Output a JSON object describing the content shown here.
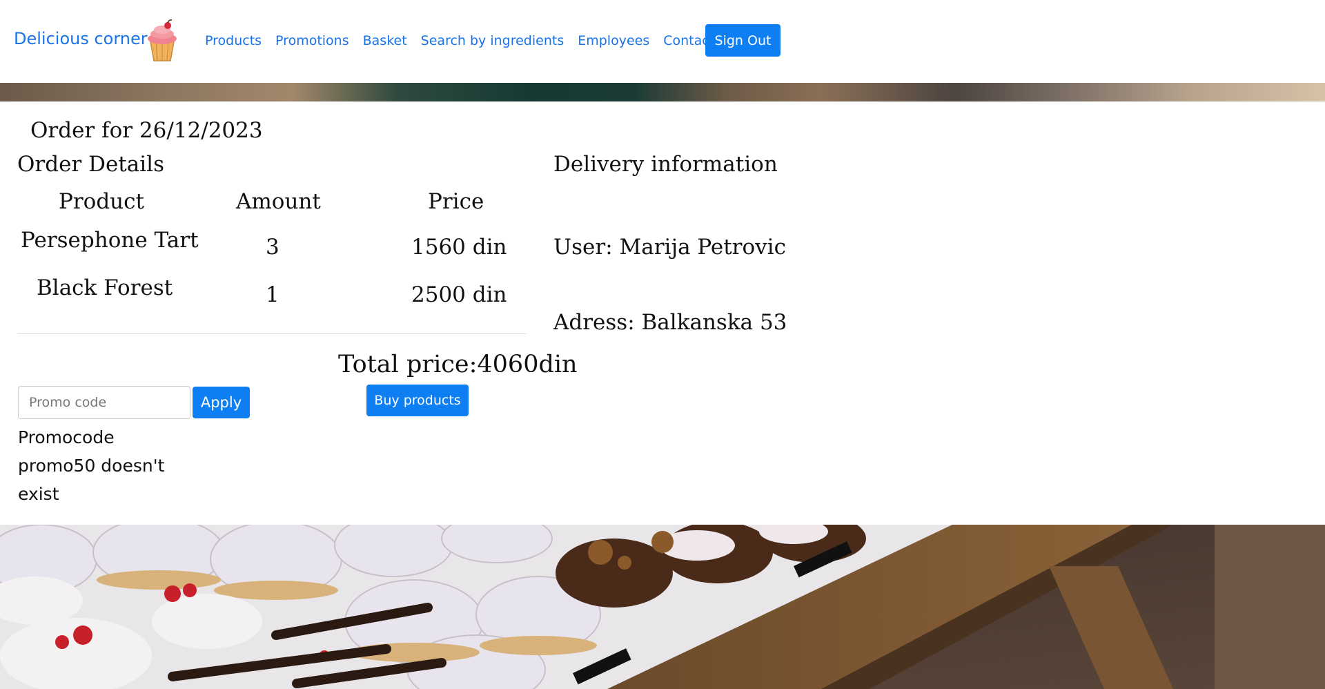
{
  "navbar": {
    "brand": "Delicious corner",
    "links": [
      "Products",
      "Promotions",
      "Basket",
      "Search by ingredients",
      "Employees",
      "Contact us"
    ],
    "signout_label": "Sign Out"
  },
  "order": {
    "title": "Order for 26/12/2023",
    "details_heading": "Order Details",
    "columns": [
      "Product",
      "Amount",
      "Price"
    ],
    "rows": [
      {
        "product": "Persephone Tart",
        "amount": "3",
        "price": "1560 din"
      },
      {
        "product": "Black Forest",
        "amount": "1",
        "price": "2500 din"
      }
    ],
    "total": "Total price:4060din",
    "buy_label": "Buy products"
  },
  "promo": {
    "placeholder": "Promo code",
    "apply_label": "Apply",
    "message": "Promocode promo50 doesn't exist"
  },
  "delivery": {
    "heading": "Delivery information",
    "user": "User: Marija Petrovic",
    "address": "Adress: Balkanska 53"
  },
  "colors": {
    "link": "#1a73e8",
    "primary_button": "#0d7ff2"
  },
  "icons": {
    "brand_logo": "cupcake-icon"
  }
}
